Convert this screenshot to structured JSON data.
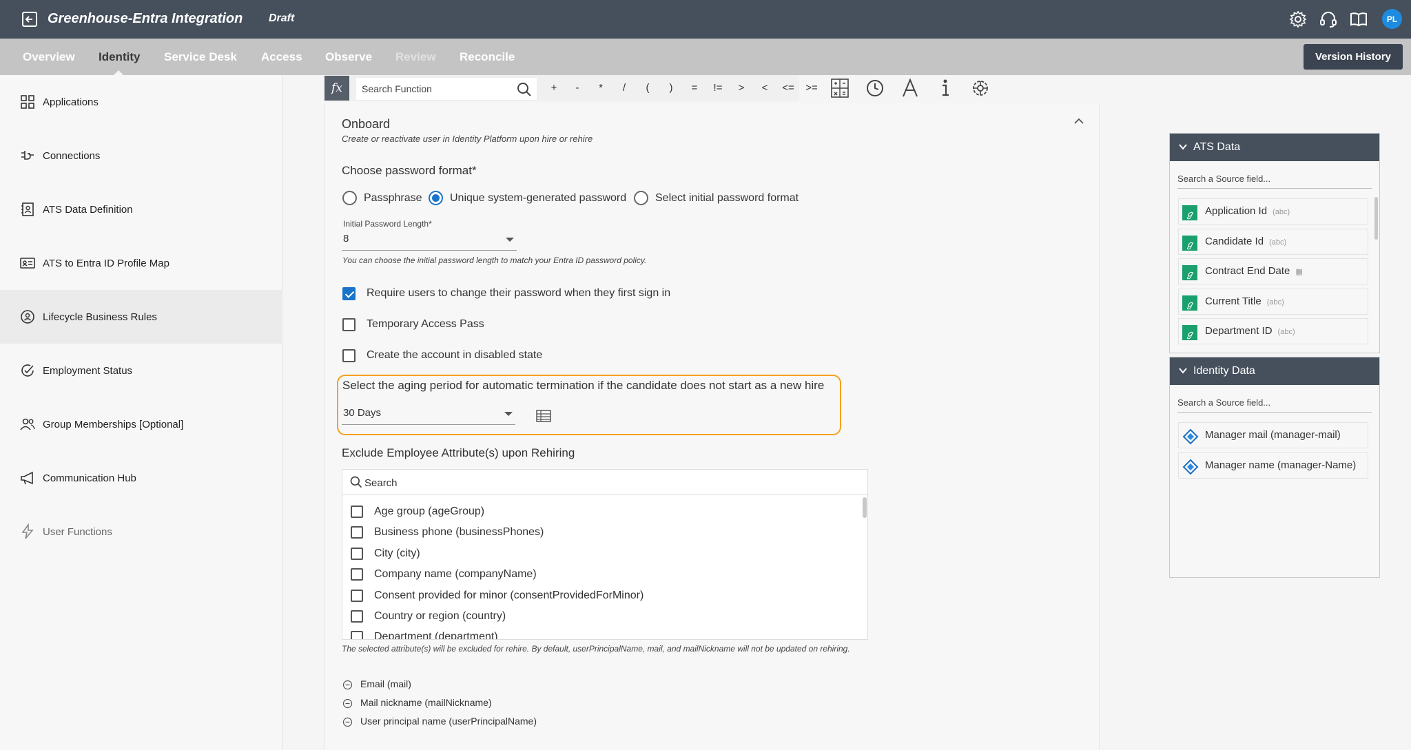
{
  "header": {
    "title": "Greenhouse-Entra Integration",
    "status": "Draft",
    "avatar_initials": "PL",
    "icons": [
      "back-icon",
      "gear-icon",
      "headset-icon",
      "book-icon"
    ]
  },
  "nav": {
    "tabs": [
      {
        "label": "Overview",
        "state": "normal"
      },
      {
        "label": "Identity",
        "state": "active"
      },
      {
        "label": "Service Desk",
        "state": "normal"
      },
      {
        "label": "Access",
        "state": "normal"
      },
      {
        "label": "Observe",
        "state": "normal"
      },
      {
        "label": "Review",
        "state": "disabled"
      },
      {
        "label": "Reconcile",
        "state": "normal"
      }
    ],
    "version_history_label": "Version History"
  },
  "sidebar": {
    "items": [
      {
        "label": "Applications",
        "icon": "grid-icon"
      },
      {
        "label": "Connections",
        "icon": "plug-icon"
      },
      {
        "label": "ATS Data Definition",
        "icon": "contact-book-icon"
      },
      {
        "label": "ATS to Entra ID Profile Map",
        "icon": "id-card-icon"
      },
      {
        "label": "Lifecycle Business Rules",
        "icon": "person-cycle-icon",
        "active": true
      },
      {
        "label": "Employment Status",
        "icon": "check-circle-icon"
      },
      {
        "label": "Group Memberships [Optional]",
        "icon": "people-icon"
      },
      {
        "label": "Communication Hub",
        "icon": "megaphone-icon"
      },
      {
        "label": "User Functions",
        "icon": "lightning-icon",
        "dim": true
      }
    ]
  },
  "function_bar": {
    "fx_label": "fx",
    "search_placeholder": "Search Function",
    "operators": [
      "+",
      "-",
      "*",
      "/",
      "(",
      ")",
      "=",
      "!=",
      ">",
      "<",
      "<=",
      ">="
    ]
  },
  "onboard": {
    "title": "Onboard",
    "subtitle": "Create or reactivate user in Identity Platform upon hire or rehire",
    "password_format_label": "Choose password format*",
    "password_options": [
      {
        "label": "Passphrase",
        "selected": false
      },
      {
        "label": "Unique system-generated password",
        "selected": true
      },
      {
        "label": "Select initial password format",
        "selected": false
      }
    ],
    "password_length_label": "Initial Password Length*",
    "password_length_value": "8",
    "password_length_hint": "You can choose the initial password length to match your Entra ID password policy.",
    "checkboxes": [
      {
        "label": "Require users to change their password when they first sign in",
        "checked": true
      },
      {
        "label": "Temporary Access Pass",
        "checked": false
      },
      {
        "label": "Create the account in disabled state",
        "checked": false
      }
    ],
    "aging_label": "Select the aging period for automatic termination if the candidate does not start as a new hire",
    "aging_value": "30 Days",
    "exclude_label": "Exclude Employee Attribute(s) upon Rehiring",
    "exclude_search_placeholder": "Search",
    "attributes": [
      "Age group (ageGroup)",
      "Business phone (businessPhones)",
      "City (city)",
      "Company name (companyName)",
      "Consent provided for minor (consentProvidedForMinor)",
      "Country or region (country)",
      "Department (department)"
    ],
    "exclude_note": "The selected attribute(s) will be excluded for rehire. By default, userPrincipalName, mail, and mailNickname will not be updated on rehiring.",
    "excluded_defaults": [
      "Email (mail)",
      "Mail nickname (mailNickname)",
      "User principal name (userPrincipalName)"
    ]
  },
  "ats_data": {
    "title": "ATS Data",
    "search_placeholder": "Search a Source field...",
    "badge": "ℊ",
    "fields": [
      {
        "name": "Application Id",
        "type": "(abc)"
      },
      {
        "name": "Candidate Id",
        "type": "(abc)"
      },
      {
        "name": "Contract End Date",
        "type": "▦"
      },
      {
        "name": "Current Title",
        "type": "(abc)"
      },
      {
        "name": "Department ID",
        "type": "(abc)"
      }
    ]
  },
  "identity_data": {
    "title": "Identity Data",
    "search_placeholder": "Search a Source field...",
    "fields": [
      {
        "name": "Manager mail (manager-mail)"
      },
      {
        "name": "Manager name (manager-Name)"
      }
    ]
  },
  "colors": {
    "header_bg": "#46505d",
    "nav_bg": "#c4c4c4",
    "accent_blue": "#1a73c8",
    "highlight_orange": "#f4a11c",
    "ats_badge_green": "#1aa06d"
  }
}
